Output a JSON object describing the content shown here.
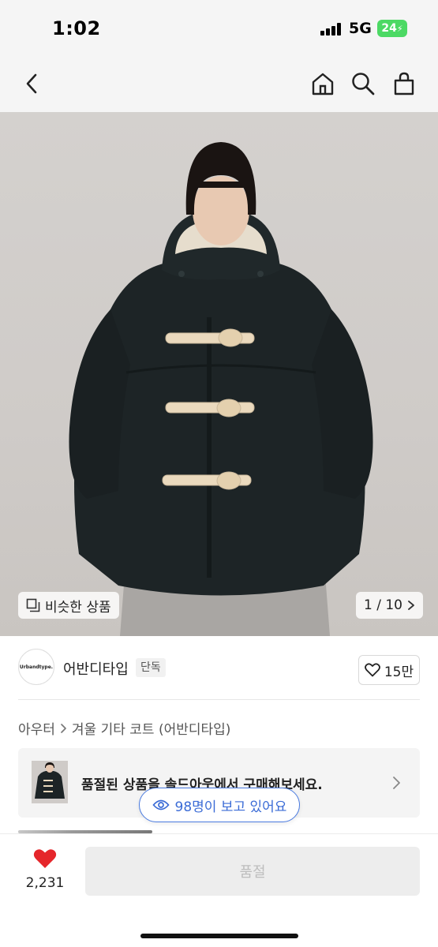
{
  "status_bar": {
    "time": "1:02",
    "network": "5G",
    "battery": "24"
  },
  "nav": {
    "back_icon": "chevron-left-icon",
    "home_icon": "home-icon",
    "search_icon": "search-icon",
    "bag_icon": "shopping-bag-icon"
  },
  "hero": {
    "similar_label": "비슷한 상품",
    "page_counter": "1 / 10"
  },
  "seller": {
    "logo_text": "Urbandtype.",
    "name": "어반디타입",
    "badge": "단독",
    "like_count": "15만"
  },
  "breadcrumb": {
    "items": [
      "아우터",
      "겨울 기타 코트 (어반디타입)"
    ]
  },
  "banner": {
    "text": "품절된 상품을 솔드아웃에서 구매해보세요."
  },
  "viewers": {
    "text": "98명이 보고 있어요"
  },
  "bottom": {
    "wish_count": "2,231",
    "buy_label": "품절"
  },
  "colors": {
    "accent_blue": "#3a6bd6",
    "heart_red": "#e5262b",
    "battery_green": "#4cd964"
  }
}
